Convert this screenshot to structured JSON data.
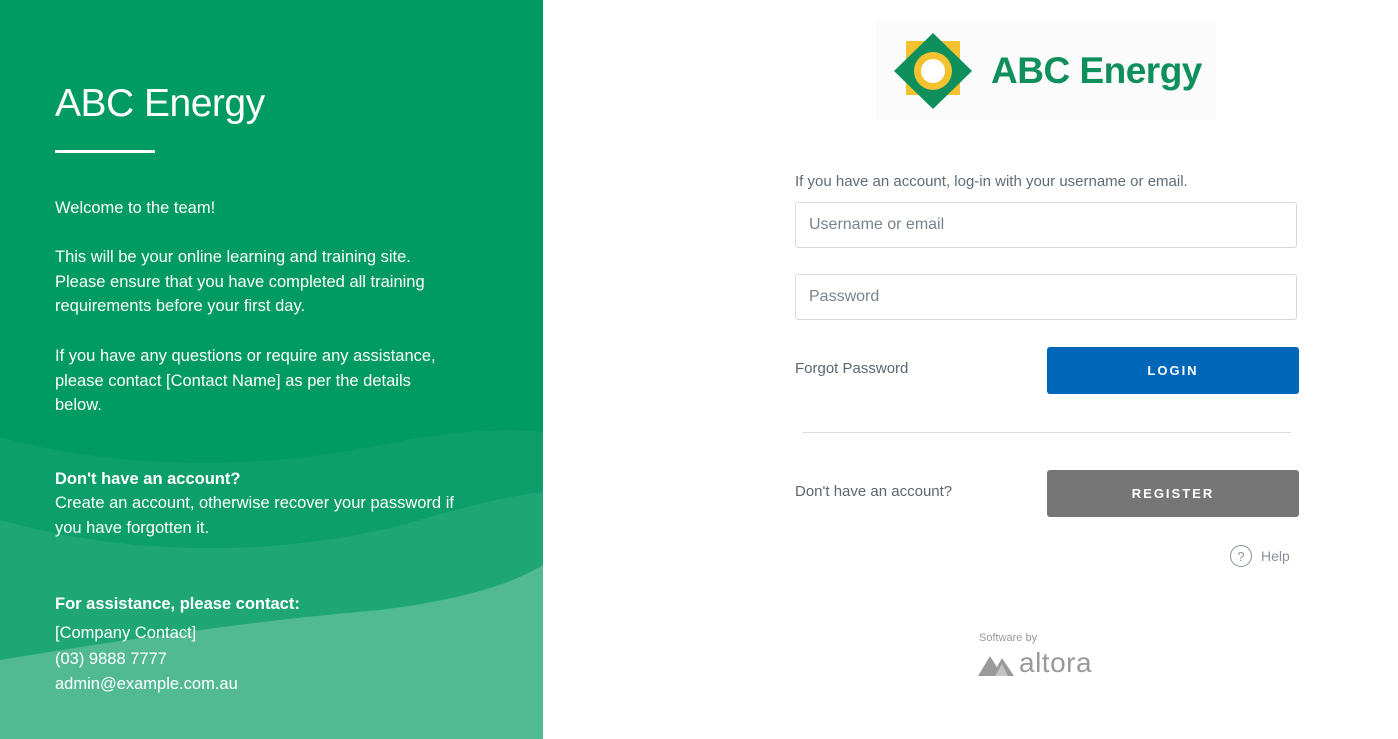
{
  "left_panel": {
    "title": "ABC Energy",
    "welcome": "Welcome to the team!",
    "intro": "This will be your online learning and training site. Please ensure that you have completed all training requirements before your first day.",
    "questions": "If you have any questions or require any assistance, please contact [Contact Name] as per the details below.",
    "no_account_title": "Don't have an account?",
    "no_account_text": "Create an account, otherwise recover your password if you have forgotten it.",
    "assistance_title": "For assistance, please contact:",
    "contact_name": "[Company Contact]",
    "contact_phone": "(03) 9888 7777",
    "contact_email": "admin@example.com.au",
    "colors": {
      "background": "#009a63"
    }
  },
  "logo": {
    "text": "ABC Energy",
    "icon": "sun-diamond-logo-icon",
    "colors": {
      "green": "#0f8f5b",
      "yellow": "#f2c230"
    }
  },
  "login_form": {
    "intro": "If you have an account, log-in with your username or email.",
    "username_placeholder": "Username or email",
    "username_value": "",
    "password_placeholder": "Password",
    "password_value": "",
    "forgot_label": "Forgot Password",
    "login_label": "LOGIN",
    "no_account_label": "Don't have an account?",
    "register_label": "REGISTER",
    "help_label": "Help",
    "help_icon": "question-circle-icon",
    "colors": {
      "login": "#0067b8",
      "register": "#767676"
    }
  },
  "footer": {
    "software_by": "Software by",
    "vendor": "altora",
    "vendor_icon": "altora-logo-icon"
  }
}
